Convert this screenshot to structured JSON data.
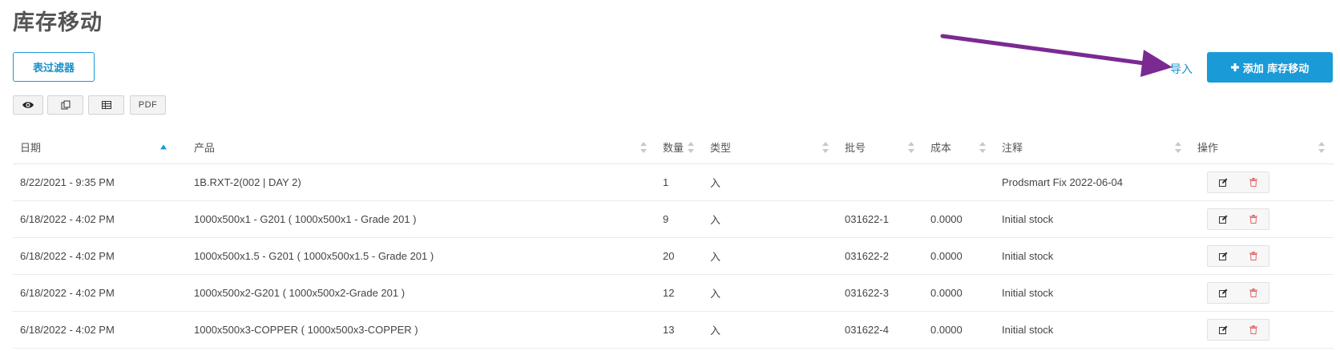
{
  "page": {
    "title": "库存移动"
  },
  "toolbar": {
    "filter_label": "表过滤器",
    "import_label": "导入",
    "add_label": "添加 库存移动",
    "view_buttons": [
      {
        "icon": "eye-icon"
      },
      {
        "icon": "copy-icon"
      },
      {
        "icon": "table-icon"
      },
      {
        "label": "PDF"
      }
    ]
  },
  "colors": {
    "accent": "#1b9ad8",
    "link": "#1a8fc9",
    "title": "#555555",
    "delete": "#e06666",
    "annotation_arrow": "#7b2a92"
  },
  "table": {
    "columns": [
      "日期",
      "产品",
      "数量",
      "类型",
      "批号",
      "成本",
      "注释",
      "操作"
    ],
    "sort": {
      "column": "日期",
      "direction": "ascending"
    },
    "rows": [
      {
        "date": "8/22/2021 - 9:35 PM",
        "product": "1B.RXT-2(002 | DAY 2)",
        "quantity": "1",
        "type": "入",
        "batch": "",
        "cost": "",
        "note": "Prodsmart Fix 2022-06-04"
      },
      {
        "date": "6/18/2022 - 4:02 PM",
        "product": "1000x500x1 - G201 ( 1000x500x1 - Grade 201 )",
        "quantity": "9",
        "type": "入",
        "batch": "031622-1",
        "cost": "0.0000",
        "note": "Initial stock"
      },
      {
        "date": "6/18/2022 - 4:02 PM",
        "product": "1000x500x1.5 - G201 ( 1000x500x1.5 - Grade 201 )",
        "quantity": "20",
        "type": "入",
        "batch": "031622-2",
        "cost": "0.0000",
        "note": "Initial stock"
      },
      {
        "date": "6/18/2022 - 4:02 PM",
        "product": "1000x500x2-G201 ( 1000x500x2-Grade 201 )",
        "quantity": "12",
        "type": "入",
        "batch": "031622-3",
        "cost": "0.0000",
        "note": "Initial stock"
      },
      {
        "date": "6/18/2022 - 4:02 PM",
        "product": "1000x500x3-COPPER ( 1000x500x3-COPPER )",
        "quantity": "13",
        "type": "入",
        "batch": "031622-4",
        "cost": "0.0000",
        "note": "Initial stock"
      }
    ]
  }
}
